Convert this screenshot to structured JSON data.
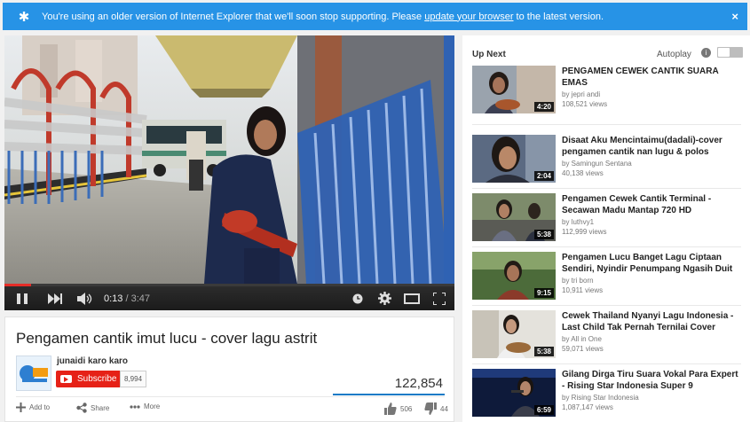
{
  "banner": {
    "message": "You're using an older version of Internet Explorer that we'll soon stop supporting. Please ",
    "link": "update your browser",
    "suffix": " to the latest version.",
    "close": "×"
  },
  "player": {
    "current_time": "0:13",
    "duration": "3:47",
    "progress": 0.06
  },
  "video": {
    "title": "Pengamen cantik imut lucu - cover lagu astrit",
    "channel": "junaidi karo karo",
    "subscribe_label": "Subscribe",
    "subscriber_count": "8,994",
    "views": "122,854",
    "actions": {
      "add_to": "Add to",
      "share": "Share",
      "more": "More",
      "likes": "506",
      "dislikes": "44"
    }
  },
  "sidebar": {
    "up_next": "Up Next",
    "autoplay": "Autoplay",
    "items": [
      {
        "title": "PENGAMEN CEWEK CANTIK SUARA EMAS",
        "channel": "by jepri andi",
        "views": "108,521 views",
        "duration": "4:20"
      },
      {
        "title": "Disaat Aku Mencintaimu(dadali)-cover pengamen cantik nan lugu & polos",
        "channel": "by Samingun Sentana",
        "views": "40,138 views",
        "duration": "2:04"
      },
      {
        "title": "Pengamen Cewek Cantik Terminal - Secawan Madu Mantap 720 HD",
        "channel": "by luthvy1",
        "views": "112,999 views",
        "duration": "5:38"
      },
      {
        "title": "Pengamen Lucu Banget Lagu Ciptaan Sendiri, Nyindir Penumpang Ngasih Duit",
        "channel": "by tri born",
        "views": "10,911 views",
        "duration": "9:15"
      },
      {
        "title": "Cewek Thailand Nyanyi Lagu Indonesia - Last Child Tak Pernah Ternilai Cover",
        "channel": "by All in One",
        "views": "59,071 views",
        "duration": "5:38"
      },
      {
        "title": "Gilang Dirga Tiru Suara Vokal Para Expert - Rising Star Indonesia Super 9",
        "channel": "by Rising Star Indonesia",
        "views": "1,087,147 views",
        "duration": "6:59"
      }
    ]
  }
}
